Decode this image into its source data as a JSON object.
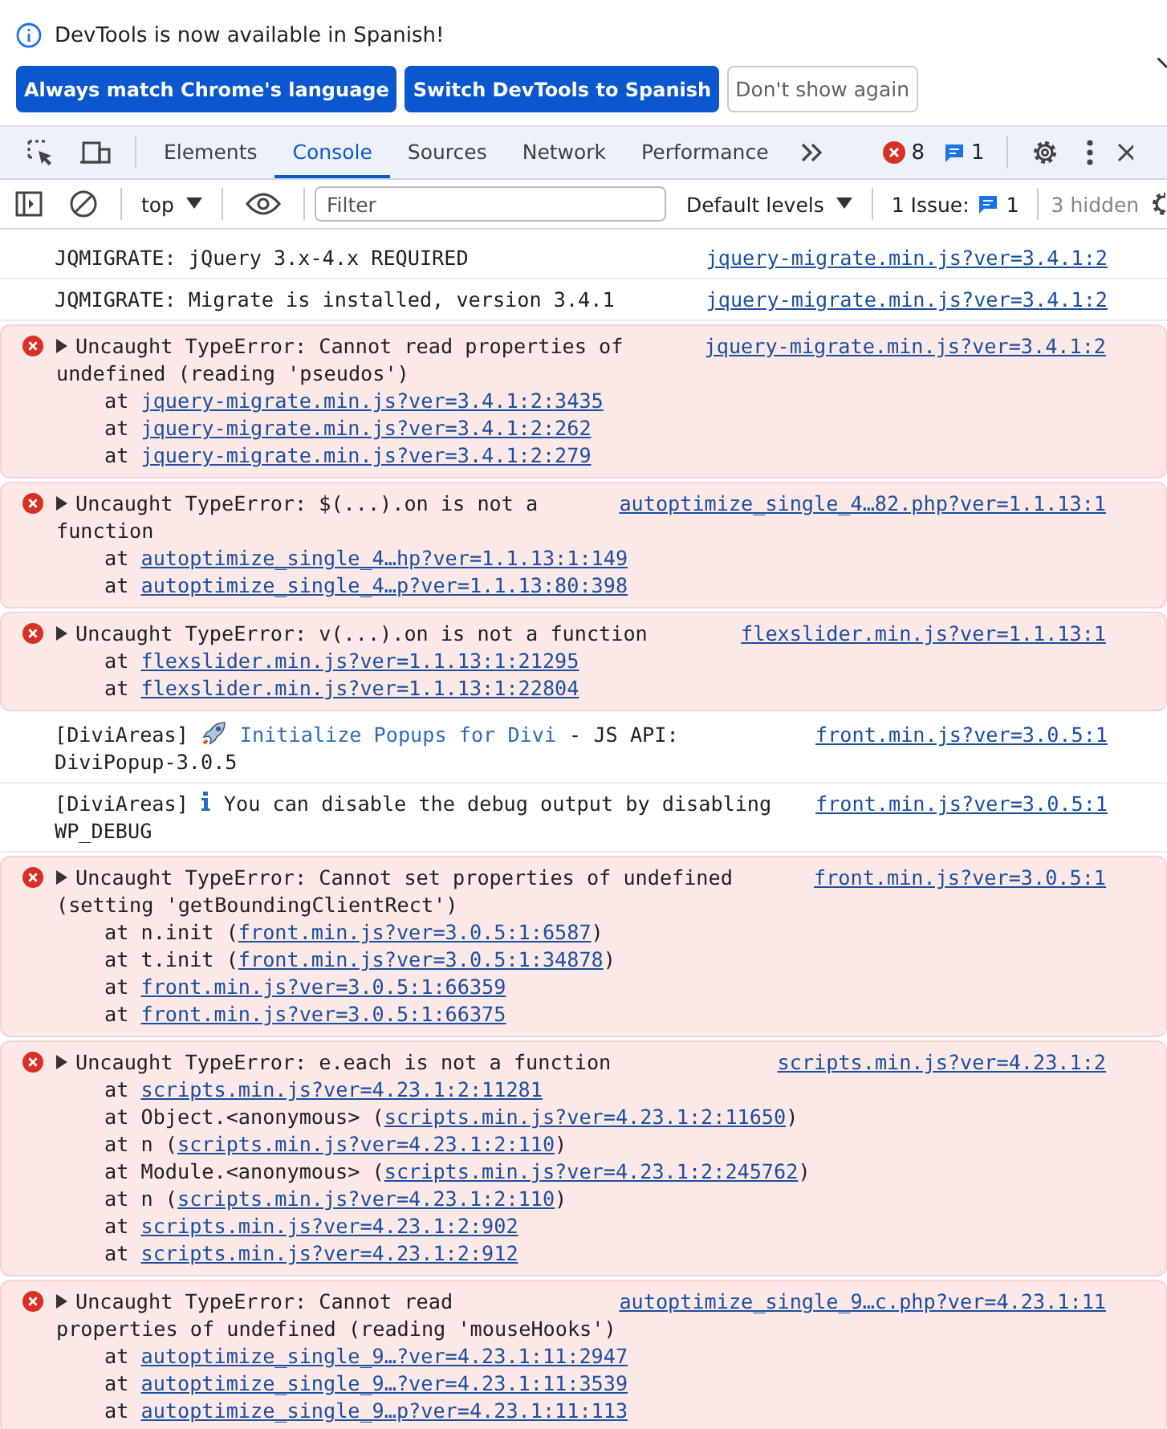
{
  "infobar": {
    "message": "DevTools is now available in Spanish!",
    "buttons": [
      {
        "label": "Always match Chrome's language",
        "kind": "primary"
      },
      {
        "label": "Switch DevTools to Spanish",
        "kind": "primary"
      },
      {
        "label": "Don't show again",
        "kind": "secondary"
      }
    ]
  },
  "tabs": [
    {
      "label": "Elements",
      "selected": false
    },
    {
      "label": "Console",
      "selected": true
    },
    {
      "label": "Sources",
      "selected": false
    },
    {
      "label": "Network",
      "selected": false
    },
    {
      "label": "Performance",
      "selected": false
    }
  ],
  "counters": {
    "errors": "8",
    "messages": "1"
  },
  "toolbar": {
    "context": "top",
    "filter": {
      "placeholder": "Filter"
    },
    "levels": "Default levels",
    "issues_label": "1 Issue:",
    "issues_count": "1",
    "hidden": "3 hidden"
  },
  "messages": [
    {
      "kind": "log",
      "lines": [
        [
          {
            "kind": "text",
            "text": "JQMIGRATE: jQuery 3.x-4.x REQUIRED"
          }
        ]
      ],
      "source": "jquery-migrate.min.js?ver=3.4.1:2"
    },
    {
      "kind": "log",
      "lines": [
        [
          {
            "kind": "text",
            "text": "JQMIGRATE: Migrate is installed, version 3.4.1"
          }
        ]
      ],
      "source": "jquery-migrate.min.js?ver=3.4.1:2"
    },
    {
      "kind": "error",
      "lines": [
        [
          {
            "kind": "text",
            "text": "Uncaught TypeError: Cannot read properties of"
          }
        ],
        [
          {
            "kind": "text",
            "text": "undefined (reading 'pseudos')"
          }
        ]
      ],
      "source": "jquery-migrate.min.js?ver=3.4.1:2",
      "frames": [
        {
          "before": "at ",
          "link": "jquery-migrate.min.js?ver=3.4.1:2:3435"
        },
        {
          "before": "at ",
          "link": "jquery-migrate.min.js?ver=3.4.1:2:262"
        },
        {
          "before": "at ",
          "link": "jquery-migrate.min.js?ver=3.4.1:2:279"
        }
      ]
    },
    {
      "kind": "error",
      "lines": [
        [
          {
            "kind": "text",
            "text": "Uncaught TypeError: $(...).on is not a"
          }
        ],
        [
          {
            "kind": "text",
            "text": "function"
          }
        ]
      ],
      "source": "autoptimize_single_4…82.php?ver=1.1.13:1",
      "frames": [
        {
          "before": "at ",
          "link": "autoptimize_single_4…hp?ver=1.1.13:1:149"
        },
        {
          "before": "at ",
          "link": "autoptimize_single_4…p?ver=1.1.13:80:398"
        }
      ]
    },
    {
      "kind": "error",
      "lines": [
        [
          {
            "kind": "text",
            "text": "Uncaught TypeError: v(...).on is not a function"
          }
        ]
      ],
      "source": "flexslider.min.js?ver=1.1.13:1",
      "frames": [
        {
          "before": "at ",
          "link": "flexslider.min.js?ver=1.1.13:1:21295"
        },
        {
          "before": "at ",
          "link": "flexslider.min.js?ver=1.1.13:1:22804"
        }
      ]
    },
    {
      "kind": "log",
      "lines": [
        [
          {
            "kind": "text",
            "text": "[DiviAreas]"
          },
          {
            "kind": "rocket"
          },
          {
            "kind": "accent",
            "text": "Initialize Popups for Divi"
          },
          {
            "kind": "text",
            "text": "- JS API:"
          }
        ],
        [
          {
            "kind": "text",
            "text": "DiviPopup-3.0.5"
          }
        ]
      ],
      "source": "front.min.js?ver=3.0.5:1"
    },
    {
      "kind": "log",
      "lines": [
        [
          {
            "kind": "text",
            "text": "[DiviAreas]"
          },
          {
            "kind": "info"
          },
          {
            "kind": "text",
            "text": "You can disable the debug output by disabling"
          }
        ],
        [
          {
            "kind": "text",
            "text": "WP_DEBUG"
          }
        ]
      ],
      "source": "front.min.js?ver=3.0.5:1"
    },
    {
      "kind": "error",
      "lines": [
        [
          {
            "kind": "text",
            "text": "Uncaught TypeError: Cannot set properties of undefined"
          }
        ],
        [
          {
            "kind": "text",
            "text": "(setting 'getBoundingClientRect')"
          }
        ]
      ],
      "source": "front.min.js?ver=3.0.5:1",
      "frames": [
        {
          "before": "at n.init (",
          "link": "front.min.js?ver=3.0.5:1:6587",
          "after": ")"
        },
        {
          "before": "at t.init (",
          "link": "front.min.js?ver=3.0.5:1:34878",
          "after": ")"
        },
        {
          "before": "at ",
          "link": "front.min.js?ver=3.0.5:1:66359"
        },
        {
          "before": "at ",
          "link": "front.min.js?ver=3.0.5:1:66375"
        }
      ]
    },
    {
      "kind": "error",
      "lines": [
        [
          {
            "kind": "text",
            "text": "Uncaught TypeError: e.each is not a function"
          }
        ]
      ],
      "source": "scripts.min.js?ver=4.23.1:2",
      "frames": [
        {
          "before": "at ",
          "link": "scripts.min.js?ver=4.23.1:2:11281"
        },
        {
          "before": "at Object.<anonymous> (",
          "link": "scripts.min.js?ver=4.23.1:2:11650",
          "after": ")"
        },
        {
          "before": "at n (",
          "link": "scripts.min.js?ver=4.23.1:2:110",
          "after": ")"
        },
        {
          "before": "at Module.<anonymous> (",
          "link": "scripts.min.js?ver=4.23.1:2:245762",
          "after": ")"
        },
        {
          "before": "at n (",
          "link": "scripts.min.js?ver=4.23.1:2:110",
          "after": ")"
        },
        {
          "before": "at ",
          "link": "scripts.min.js?ver=4.23.1:2:902"
        },
        {
          "before": "at ",
          "link": "scripts.min.js?ver=4.23.1:2:912"
        }
      ]
    },
    {
      "kind": "error",
      "lines": [
        [
          {
            "kind": "text",
            "text": "Uncaught TypeError: Cannot read"
          }
        ],
        [
          {
            "kind": "text",
            "text": "properties of undefined (reading 'mouseHooks')"
          }
        ]
      ],
      "source": "autoptimize_single_9…c.php?ver=4.23.1:11",
      "frames": [
        {
          "before": "at ",
          "link": "autoptimize_single_9…?ver=4.23.1:11:2947"
        },
        {
          "before": "at ",
          "link": "autoptimize_single_9…?ver=4.23.1:11:3539"
        },
        {
          "before": "at ",
          "link": "autoptimize_single_9…p?ver=4.23.1:11:113"
        }
      ]
    }
  ]
}
